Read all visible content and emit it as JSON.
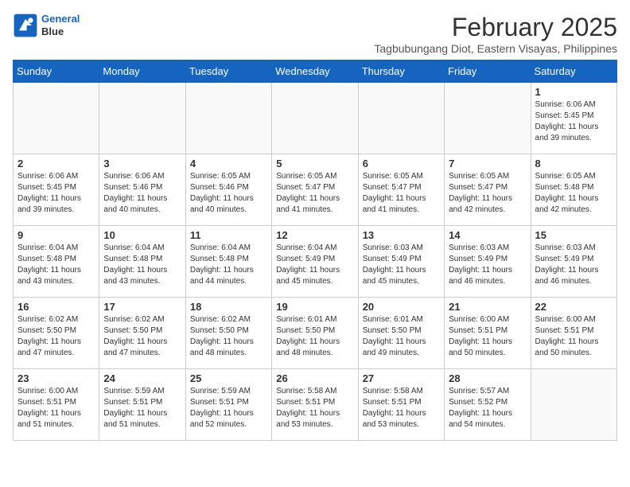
{
  "logo": {
    "line1": "General",
    "line2": "Blue"
  },
  "title": "February 2025",
  "subtitle": "Tagbubungang Diot, Eastern Visayas, Philippines",
  "weekdays": [
    "Sunday",
    "Monday",
    "Tuesday",
    "Wednesday",
    "Thursday",
    "Friday",
    "Saturday"
  ],
  "weeks": [
    [
      {
        "day": "",
        "info": ""
      },
      {
        "day": "",
        "info": ""
      },
      {
        "day": "",
        "info": ""
      },
      {
        "day": "",
        "info": ""
      },
      {
        "day": "",
        "info": ""
      },
      {
        "day": "",
        "info": ""
      },
      {
        "day": "1",
        "info": "Sunrise: 6:06 AM\nSunset: 5:45 PM\nDaylight: 11 hours and 39 minutes."
      }
    ],
    [
      {
        "day": "2",
        "info": "Sunrise: 6:06 AM\nSunset: 5:45 PM\nDaylight: 11 hours and 39 minutes."
      },
      {
        "day": "3",
        "info": "Sunrise: 6:06 AM\nSunset: 5:46 PM\nDaylight: 11 hours and 40 minutes."
      },
      {
        "day": "4",
        "info": "Sunrise: 6:05 AM\nSunset: 5:46 PM\nDaylight: 11 hours and 40 minutes."
      },
      {
        "day": "5",
        "info": "Sunrise: 6:05 AM\nSunset: 5:47 PM\nDaylight: 11 hours and 41 minutes."
      },
      {
        "day": "6",
        "info": "Sunrise: 6:05 AM\nSunset: 5:47 PM\nDaylight: 11 hours and 41 minutes."
      },
      {
        "day": "7",
        "info": "Sunrise: 6:05 AM\nSunset: 5:47 PM\nDaylight: 11 hours and 42 minutes."
      },
      {
        "day": "8",
        "info": "Sunrise: 6:05 AM\nSunset: 5:48 PM\nDaylight: 11 hours and 42 minutes."
      }
    ],
    [
      {
        "day": "9",
        "info": "Sunrise: 6:04 AM\nSunset: 5:48 PM\nDaylight: 11 hours and 43 minutes."
      },
      {
        "day": "10",
        "info": "Sunrise: 6:04 AM\nSunset: 5:48 PM\nDaylight: 11 hours and 43 minutes."
      },
      {
        "day": "11",
        "info": "Sunrise: 6:04 AM\nSunset: 5:48 PM\nDaylight: 11 hours and 44 minutes."
      },
      {
        "day": "12",
        "info": "Sunrise: 6:04 AM\nSunset: 5:49 PM\nDaylight: 11 hours and 45 minutes."
      },
      {
        "day": "13",
        "info": "Sunrise: 6:03 AM\nSunset: 5:49 PM\nDaylight: 11 hours and 45 minutes."
      },
      {
        "day": "14",
        "info": "Sunrise: 6:03 AM\nSunset: 5:49 PM\nDaylight: 11 hours and 46 minutes."
      },
      {
        "day": "15",
        "info": "Sunrise: 6:03 AM\nSunset: 5:49 PM\nDaylight: 11 hours and 46 minutes."
      }
    ],
    [
      {
        "day": "16",
        "info": "Sunrise: 6:02 AM\nSunset: 5:50 PM\nDaylight: 11 hours and 47 minutes."
      },
      {
        "day": "17",
        "info": "Sunrise: 6:02 AM\nSunset: 5:50 PM\nDaylight: 11 hours and 47 minutes."
      },
      {
        "day": "18",
        "info": "Sunrise: 6:02 AM\nSunset: 5:50 PM\nDaylight: 11 hours and 48 minutes."
      },
      {
        "day": "19",
        "info": "Sunrise: 6:01 AM\nSunset: 5:50 PM\nDaylight: 11 hours and 48 minutes."
      },
      {
        "day": "20",
        "info": "Sunrise: 6:01 AM\nSunset: 5:50 PM\nDaylight: 11 hours and 49 minutes."
      },
      {
        "day": "21",
        "info": "Sunrise: 6:00 AM\nSunset: 5:51 PM\nDaylight: 11 hours and 50 minutes."
      },
      {
        "day": "22",
        "info": "Sunrise: 6:00 AM\nSunset: 5:51 PM\nDaylight: 11 hours and 50 minutes."
      }
    ],
    [
      {
        "day": "23",
        "info": "Sunrise: 6:00 AM\nSunset: 5:51 PM\nDaylight: 11 hours and 51 minutes."
      },
      {
        "day": "24",
        "info": "Sunrise: 5:59 AM\nSunset: 5:51 PM\nDaylight: 11 hours and 51 minutes."
      },
      {
        "day": "25",
        "info": "Sunrise: 5:59 AM\nSunset: 5:51 PM\nDaylight: 11 hours and 52 minutes."
      },
      {
        "day": "26",
        "info": "Sunrise: 5:58 AM\nSunset: 5:51 PM\nDaylight: 11 hours and 53 minutes."
      },
      {
        "day": "27",
        "info": "Sunrise: 5:58 AM\nSunset: 5:51 PM\nDaylight: 11 hours and 53 minutes."
      },
      {
        "day": "28",
        "info": "Sunrise: 5:57 AM\nSunset: 5:52 PM\nDaylight: 11 hours and 54 minutes."
      },
      {
        "day": "",
        "info": ""
      }
    ]
  ]
}
